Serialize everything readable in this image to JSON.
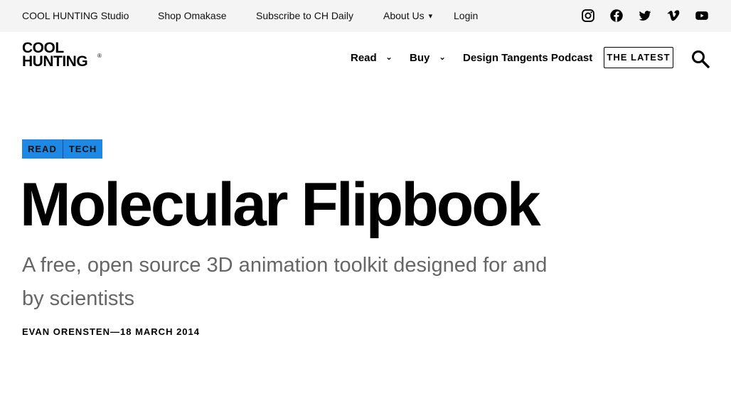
{
  "topbar": {
    "links": [
      "COOL HUNTING Studio",
      "Shop Omakase",
      "Subscribe to CH Daily",
      "About Us",
      "Login"
    ],
    "social": [
      "instagram-icon",
      "facebook-icon",
      "twitter-icon",
      "vimeo-icon",
      "youtube-icon"
    ]
  },
  "header": {
    "logo_line1": "COOL",
    "logo_line2": "HUNTING",
    "logo_reg": "®",
    "nav": [
      "Read",
      "Buy",
      "Design Tangents Podcast"
    ],
    "latest_label": "THE LATEST"
  },
  "article": {
    "tags": [
      "READ",
      "TECH"
    ],
    "title": "Molecular Flipbook",
    "subtitle": "A free, open source 3D animation toolkit designed for and by scientists",
    "author": "EVAN ORENSTEN",
    "separator": "—",
    "date": "18 MARCH 2014"
  },
  "colors": {
    "tag_bg": "#1e88e5",
    "topbar_bg": "#f4f4f4",
    "subtitle": "#666666"
  }
}
